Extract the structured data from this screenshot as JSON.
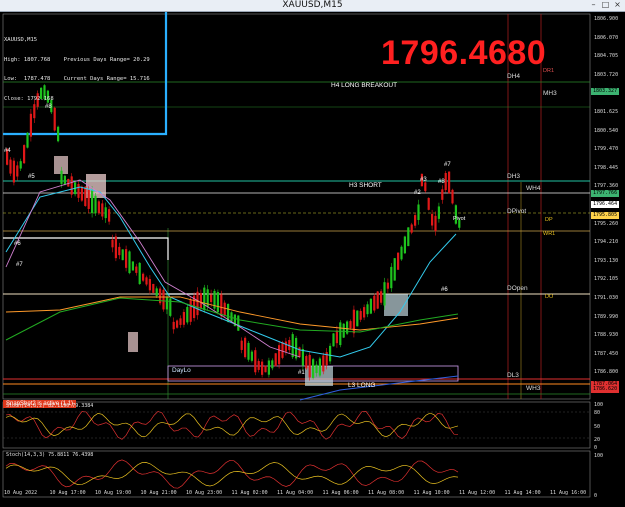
{
  "window": {
    "title": "XAUUSD,M15"
  },
  "info": {
    "symbol": "XAUUSD,M15",
    "line1": "High: 1807.768    Previous Days Range= 20.29",
    "line2": "Low:  1787.478    Current Days Range= 15.716",
    "line3": "Close: 1792.168"
  },
  "big_price": "1796.4680",
  "labels": {
    "h4_breakout": "H4 LONG BREAKOUT",
    "h3_short": "H3 SHORT",
    "l3_long": "L3 LONG",
    "daylo": "DayLo",
    "pivot": "Pivot",
    "snapshot": "SnapShot2 is active (1.1)"
  },
  "levels": {
    "dh4": "DH4",
    "mh3": "MH3",
    "dh3": "DH3",
    "wh4": "WH4",
    "dpivot": "DPivot",
    "dp": "DP",
    "wr1": "WR1",
    "dr1": "DR1",
    "dopen": "DOpen",
    "do": "DO",
    "dl3": "DL3",
    "wh3": "WH3"
  },
  "markers": [
    "#4",
    "#5",
    "#6",
    "#7",
    "#8",
    "#3",
    "#2",
    "#1",
    "#6",
    "#7",
    "#8"
  ],
  "price_axis": [
    "1806.900",
    "1806.070",
    "1804.705",
    "1803.720",
    "1802.670",
    "1801.625",
    "1800.540",
    "1799.470",
    "1798.445",
    "1797.360",
    "1796.464",
    "1795.260",
    "1794.210",
    "1793.130",
    "1792.105",
    "1791.030",
    "1789.990",
    "1788.930",
    "1787.450",
    "1786.800",
    "1785.750"
  ],
  "price_tags": [
    {
      "text": "1803.327",
      "color": "#3cb371"
    },
    {
      "text": "1797.766",
      "color": "#3cb371"
    },
    {
      "text": "1796.464",
      "color": "#ffffff"
    },
    {
      "text": "1795.805",
      "color": "#ffd24a"
    },
    {
      "text": "1787.064",
      "color": "#e03030"
    },
    {
      "text": "1786.620",
      "color": "#e03030"
    }
  ],
  "indicators": {
    "stoch1": "Stoch(14,8,2) 82.1190 79.3384",
    "stoch2": "Stoch(14,3,3) 75.8811 76.4398",
    "axis1": [
      "100",
      "80",
      "50",
      "20",
      "0"
    ],
    "axis2": [
      "100",
      "0"
    ]
  },
  "time_axis": [
    "10 Aug 2022",
    "10 Aug 17:00",
    "10 Aug 19:00",
    "10 Aug 21:00",
    "10 Aug 23:00",
    "11 Aug 02:00",
    "11 Aug 04:00",
    "11 Aug 06:00",
    "11 Aug 08:00",
    "11 Aug 10:00",
    "11 Aug 12:00",
    "11 Aug 14:00",
    "11 Aug 16:00"
  ],
  "colors": {
    "up": "#1ec21e",
    "down": "#e01818",
    "gridline": "#2a2a2a",
    "ema_cyan": "#33ccee",
    "ma_orange": "#ff9a2a",
    "ma_green": "#22aa22",
    "stoch_red": "#e03030",
    "stoch_yellow": "#e8c020"
  }
}
